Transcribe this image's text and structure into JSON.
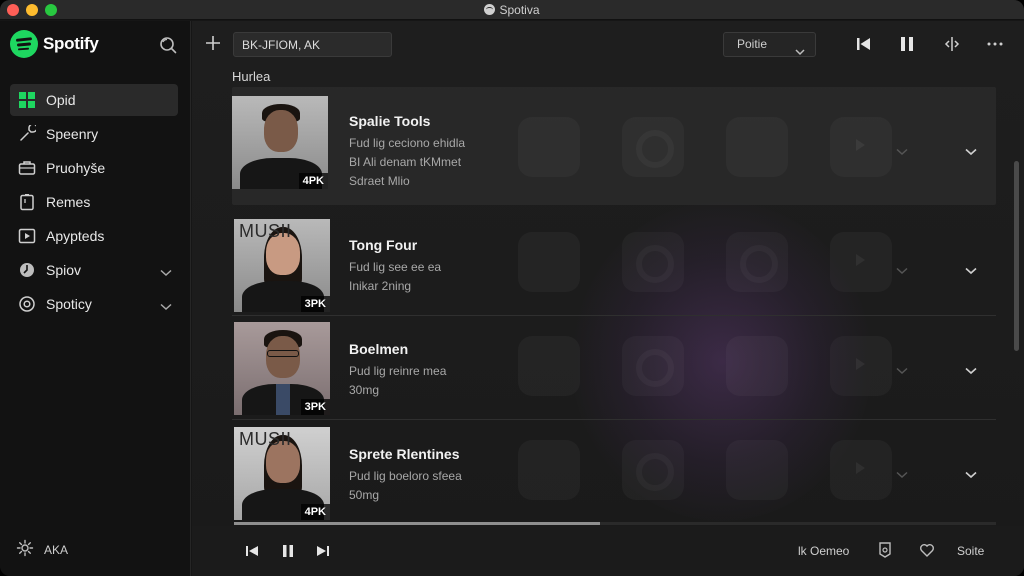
{
  "window": {
    "title": "Spotiva"
  },
  "sidebar": {
    "logo_text": "Spotify",
    "items": [
      {
        "label": "Opid",
        "icon": "grid-icon",
        "active": true
      },
      {
        "label": "Speenry",
        "icon": "wrench-icon"
      },
      {
        "label": "Pruohyše",
        "icon": "briefcase-icon"
      },
      {
        "label": "Remes",
        "icon": "clipboard-icon"
      },
      {
        "label": "Apyptеds",
        "icon": "play-screen-icon"
      },
      {
        "label": "Spiov",
        "icon": "circle-icon",
        "expandable": true
      },
      {
        "label": "Spoticy",
        "icon": "settings-icon",
        "expandable": true
      }
    ],
    "footer_label": "AKA"
  },
  "toolbar": {
    "path_value": "BK-JFIOM, AK",
    "dropdown_value": "Poitie"
  },
  "section_title": "Hurlea",
  "tracks": [
    {
      "title": "Spalie Tools",
      "lines": [
        "Fud lig ceciono ehidla",
        "BI Ali denam tKMmet",
        "Sdraet Mlio"
      ],
      "badge": "4PK",
      "thumb_overlay": "",
      "highlighted": true
    },
    {
      "title": "Tong Four",
      "lines": [
        "Fud lig see ee ea",
        "Inikar 2ning"
      ],
      "badge": "3PK",
      "thumb_overlay": "MUSII",
      "highlighted": false
    },
    {
      "title": "Boelmen",
      "lines": [
        "Pud lig reinre mea",
        "30mg"
      ],
      "badge": "3PK",
      "thumb_overlay": "",
      "highlighted": false
    },
    {
      "title": "Sprete Rlentines",
      "lines": [
        "Pud lig boeloro sfeea",
        "50mg"
      ],
      "badge": "4PK",
      "thumb_overlay": "MUSII",
      "highlighted": false
    }
  ],
  "playbar": {
    "device_label": "lk Oemeo",
    "volume_label": "Soite"
  },
  "progress": {
    "fraction": 0.48
  },
  "colors": {
    "accent": "#1ed760",
    "background": "#161616",
    "sidebar": "#121212"
  }
}
